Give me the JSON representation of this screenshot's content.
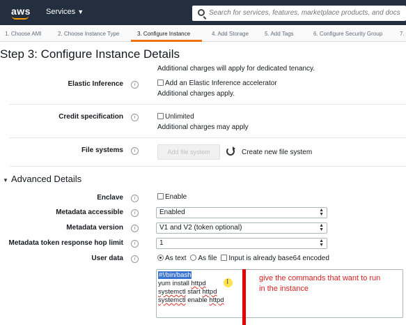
{
  "nav": {
    "logo": "aws",
    "services_label": "Services",
    "search_placeholder": "Search for services, features, marketplace products, and docs"
  },
  "steps": [
    "1. Choose AMI",
    "2. Choose Instance Type",
    "3. Configure Instance",
    "4. Add Storage",
    "5. Add Tags",
    "6. Configure Security Group",
    "7."
  ],
  "active_step": "3. Configure Instance",
  "page_title": "Step 3: Configure Instance Details",
  "tenancy_note": "Additional charges will apply for dedicated tenancy.",
  "elastic_inference": {
    "label": "Elastic Inference",
    "checkbox_label": "Add an Elastic Inference accelerator",
    "note": "Additional charges apply."
  },
  "credit_spec": {
    "label": "Credit specification",
    "checkbox_label": "Unlimited",
    "note": "Additional charges may apply"
  },
  "file_systems": {
    "label": "File systems",
    "add_button": "Add file system",
    "create_link": "Create new file system"
  },
  "advanced": {
    "title": "Advanced Details",
    "enclave": {
      "label": "Enclave",
      "checkbox_label": "Enable"
    },
    "metadata_accessible": {
      "label": "Metadata accessible",
      "value": "Enabled"
    },
    "metadata_version": {
      "label": "Metadata version",
      "value": "V1 and V2 (token optional)"
    },
    "hop_limit": {
      "label": "Metadata token response hop limit",
      "value": "1"
    },
    "user_data": {
      "label": "User data",
      "as_text": "As text",
      "as_file": "As file",
      "base64": "Input is already base64 encoded",
      "lines": [
        "#!/bin/bash",
        "yum install httpd",
        "systemctl start httpd",
        "systemctl enable httpd"
      ]
    }
  },
  "annotation": {
    "line1": "give the commands that want to run",
    "line2": "in the instance",
    "color": "#d82020"
  },
  "colors": {
    "nav_bg": "#232f3e",
    "accent": "#ec7211",
    "link": "#0073bb"
  }
}
